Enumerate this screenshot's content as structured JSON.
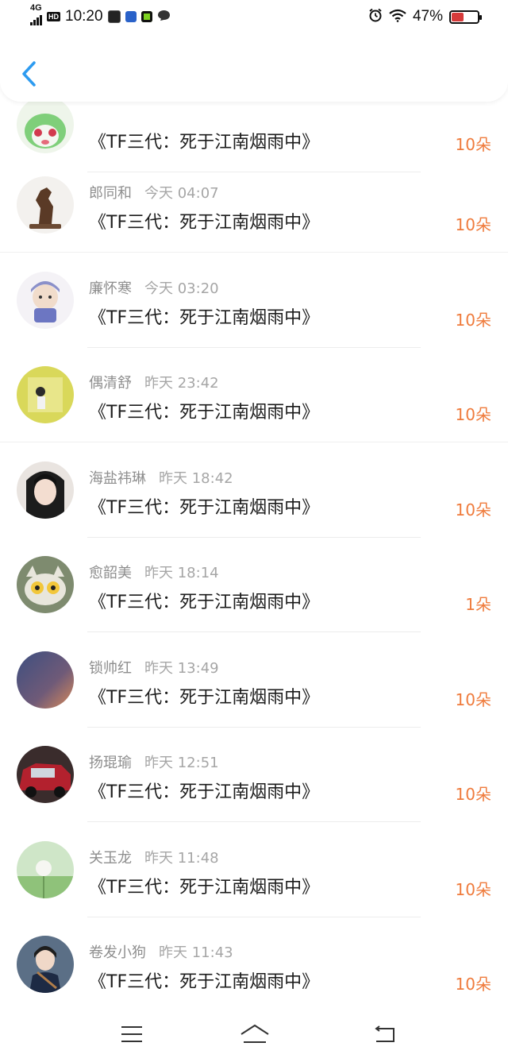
{
  "status_bar": {
    "network": "4G",
    "hd_badge": "HD",
    "time": "10:20",
    "battery": "47%",
    "icons": [
      "signal-icon",
      "hd-icon",
      "app-icon-1",
      "app-icon-2",
      "app-icon-3",
      "message-icon",
      "alarm-icon",
      "wifi-icon",
      "battery-icon"
    ]
  },
  "header": {
    "back_icon": "back-chevron-icon"
  },
  "items": [
    {
      "name": "",
      "time": "",
      "title": "《TF三代：死于江南烟雨中》",
      "amount": "10朵",
      "avatar": "green-creature"
    },
    {
      "name": "郎同和",
      "time": "今天 04:07",
      "title": "《TF三代：死于江南烟雨中》",
      "amount": "10朵",
      "avatar": "horse-statue"
    },
    {
      "name": "廉怀寒",
      "time": "今天 03:20",
      "title": "《TF三代：死于江南烟雨中》",
      "amount": "10朵",
      "avatar": "cartoon-character"
    },
    {
      "name": "偶清舒",
      "time": "昨天 23:42",
      "title": "《TF三代：死于江南烟雨中》",
      "amount": "10朵",
      "avatar": "yellow-photo"
    },
    {
      "name": "海盐祎琳",
      "time": "昨天 18:42",
      "title": "《TF三代：死于江南烟雨中》",
      "amount": "10朵",
      "avatar": "girl-portrait"
    },
    {
      "name": "愈韶美",
      "time": "昨天 18:14",
      "title": "《TF三代：死于江南烟雨中》",
      "amount": "1朵",
      "avatar": "cat-cartoon"
    },
    {
      "name": "锁帅红",
      "time": "昨天 13:49",
      "title": "《TF三代：死于江南烟雨中》",
      "amount": "10朵",
      "avatar": "dusk-sky"
    },
    {
      "name": "扬琨瑜",
      "time": "昨天 12:51",
      "title": "《TF三代：死于江南烟雨中》",
      "amount": "10朵",
      "avatar": "red-car"
    },
    {
      "name": "关玉龙",
      "time": "昨天 11:48",
      "title": "《TF三代：死于江南烟雨中》",
      "amount": "10朵",
      "avatar": "dandelion"
    },
    {
      "name": "卷发小狗",
      "time": "昨天 11:43",
      "title": "《TF三代：死于江南烟雨中》",
      "amount": "10朵",
      "avatar": "girl-with-instrument"
    }
  ],
  "bottom_nav": {
    "icons": [
      "menu-icon",
      "home-icon",
      "back-icon"
    ]
  },
  "colors": {
    "amount": "#ef7b3c",
    "accent": "#2d9bf0",
    "name": "#8e8e8e"
  }
}
